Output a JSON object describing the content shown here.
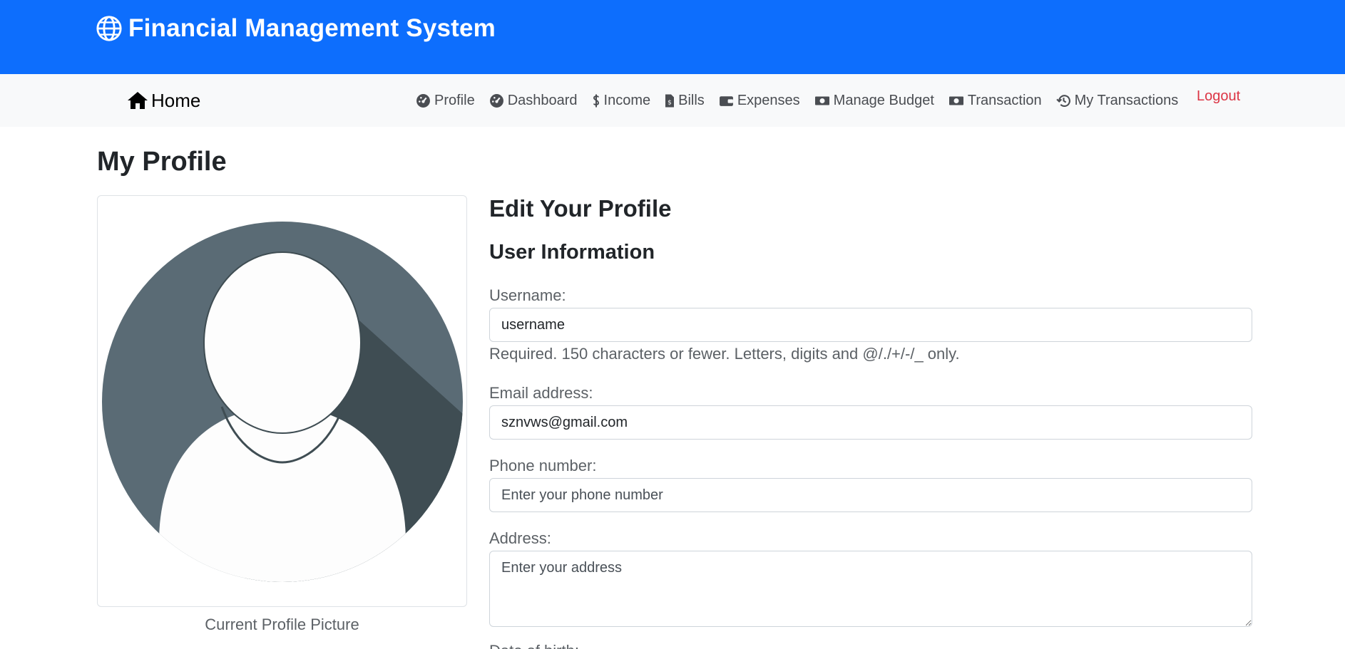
{
  "header": {
    "brand": "Financial Management System",
    "brand_icon": "globe-icon",
    "bg_color": "#0d6efd"
  },
  "nav": {
    "home": {
      "label": "Home",
      "icon": "house-icon"
    },
    "items": [
      {
        "label": "Profile",
        "icon": "gauge-icon"
      },
      {
        "label": "Dashboard",
        "icon": "gauge-icon"
      },
      {
        "label": "Income",
        "icon": "dollar-icon"
      },
      {
        "label": "Bills",
        "icon": "receipt-icon"
      },
      {
        "label": "Expenses",
        "icon": "wallet-icon"
      },
      {
        "label": "Manage Budget",
        "icon": "money-bill-icon"
      },
      {
        "label": "Transaction",
        "icon": "money-bill-icon"
      },
      {
        "label": "My Transactions",
        "icon": "history-icon"
      }
    ],
    "logout": "Logout",
    "logout_color": "#dc3545"
  },
  "page": {
    "title": "My Profile",
    "profile_picture_caption": "Current Profile Picture"
  },
  "form": {
    "title": "Edit Your Profile",
    "section": "User Information",
    "username": {
      "label": "Username:",
      "value": "username",
      "help": "Required. 150 characters or fewer. Letters, digits and @/./+/-/_ only."
    },
    "email": {
      "label": "Email address:",
      "value": "sznvws@gmail.com"
    },
    "phone": {
      "label": "Phone number:",
      "placeholder": "Enter your phone number"
    },
    "address": {
      "label": "Address:",
      "placeholder": "Enter your address"
    },
    "dob": {
      "label": "Date of birth:"
    }
  }
}
